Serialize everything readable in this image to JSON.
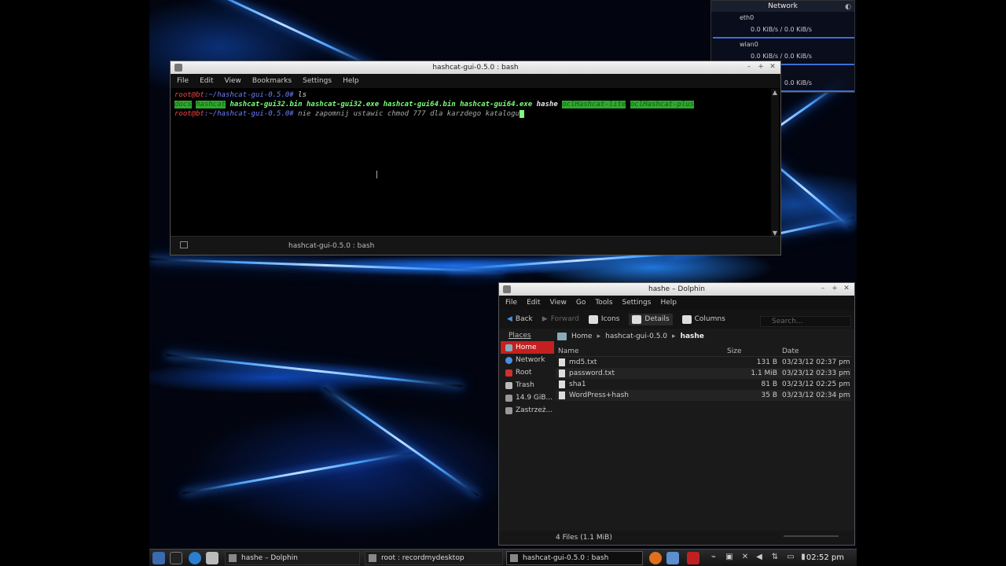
{
  "network_widget": {
    "title": "Network",
    "interfaces": [
      {
        "name": "eth0",
        "rate": "0.0 KiB/s / 0.0 KiB/s"
      },
      {
        "name": "wlan0",
        "rate": "0.0 KiB/s / 0.0 KiB/s"
      },
      {
        "name": "",
        "rate": "0.0 KiB/s"
      }
    ]
  },
  "terminal": {
    "title": "hashcat-gui-0.5.0 : bash",
    "menu": [
      "File",
      "Edit",
      "View",
      "Bookmarks",
      "Settings",
      "Help"
    ],
    "lines": {
      "line1_prompt": "root@bt",
      "line1_path": ":~/hashcat-gui-0.5.0#",
      "line1_cmd": " ls",
      "ls_items": [
        {
          "text": "docs",
          "style": "highlight"
        },
        {
          "text": "hashcat",
          "style": "highlight"
        },
        {
          "text": "hashcat-gui32.bin",
          "style": "exec"
        },
        {
          "text": "hashcat-gui32.exe",
          "style": "exec"
        },
        {
          "text": "hashcat-gui64.bin",
          "style": "exec"
        },
        {
          "text": "hashcat-gui64.exe",
          "style": "exec"
        },
        {
          "text": "hashe",
          "style": "plain"
        },
        {
          "text": "oclHashcat-lite",
          "style": "highlight"
        },
        {
          "text": "oclHashcat-plus",
          "style": "highlight"
        }
      ],
      "line3_prompt": "root@bt",
      "line3_path": ":~/hashcat-gui-0.5.0#",
      "line3_cmd": " nie zapomnij ustawic chmod 777 dla karzdego katalogu"
    },
    "tab_label": "hashcat-gui-0.5.0 : bash"
  },
  "dolphin": {
    "title": "hashe – Dolphin",
    "menu": [
      "File",
      "Edit",
      "View",
      "Go",
      "Tools",
      "Settings",
      "Help"
    ],
    "toolbar": {
      "back": "Back",
      "forward": "Forward",
      "icons": "Icons",
      "details": "Details",
      "columns": "Columns",
      "search_placeholder": "Search..."
    },
    "places": {
      "header": "Places",
      "items": [
        {
          "label": "Home",
          "active": true
        },
        {
          "label": "Network",
          "active": false
        },
        {
          "label": "Root",
          "active": false
        },
        {
          "label": "Trash",
          "active": false
        },
        {
          "label": "14.9 GiB...",
          "active": false
        },
        {
          "label": "Zastrzeż...",
          "active": false
        }
      ]
    },
    "breadcrumb": [
      "Home",
      "hashcat-gui-0.5.0",
      "hashe"
    ],
    "columns": {
      "name": "Name",
      "size": "Size",
      "date": "Date"
    },
    "files": [
      {
        "name": "md5.txt",
        "size": "131 B",
        "date": "03/23/12 02:37 pm"
      },
      {
        "name": "password.txt",
        "size": "1.1 MiB",
        "date": "03/23/12 02:33 pm"
      },
      {
        "name": "sha1",
        "size": "81 B",
        "date": "03/23/12 02:25 pm"
      },
      {
        "name": "WordPress+hash",
        "size": "35 B",
        "date": "03/23/12 02:34 pm"
      }
    ],
    "status": "4 Files (1.1 MiB)"
  },
  "taskbar": {
    "tasks": [
      {
        "label": "hashe – Dolphin",
        "active": false
      },
      {
        "label": "root : recordmydesktop",
        "active": false
      },
      {
        "label": "hashcat-gui-0.5.0 : bash",
        "active": true
      }
    ],
    "clock": "02:52 pm"
  },
  "colors": {
    "prompt": "#ff4444",
    "path": "#6f7fff",
    "dir_highlight": "#2ea82e",
    "places_active": "#c42020"
  }
}
